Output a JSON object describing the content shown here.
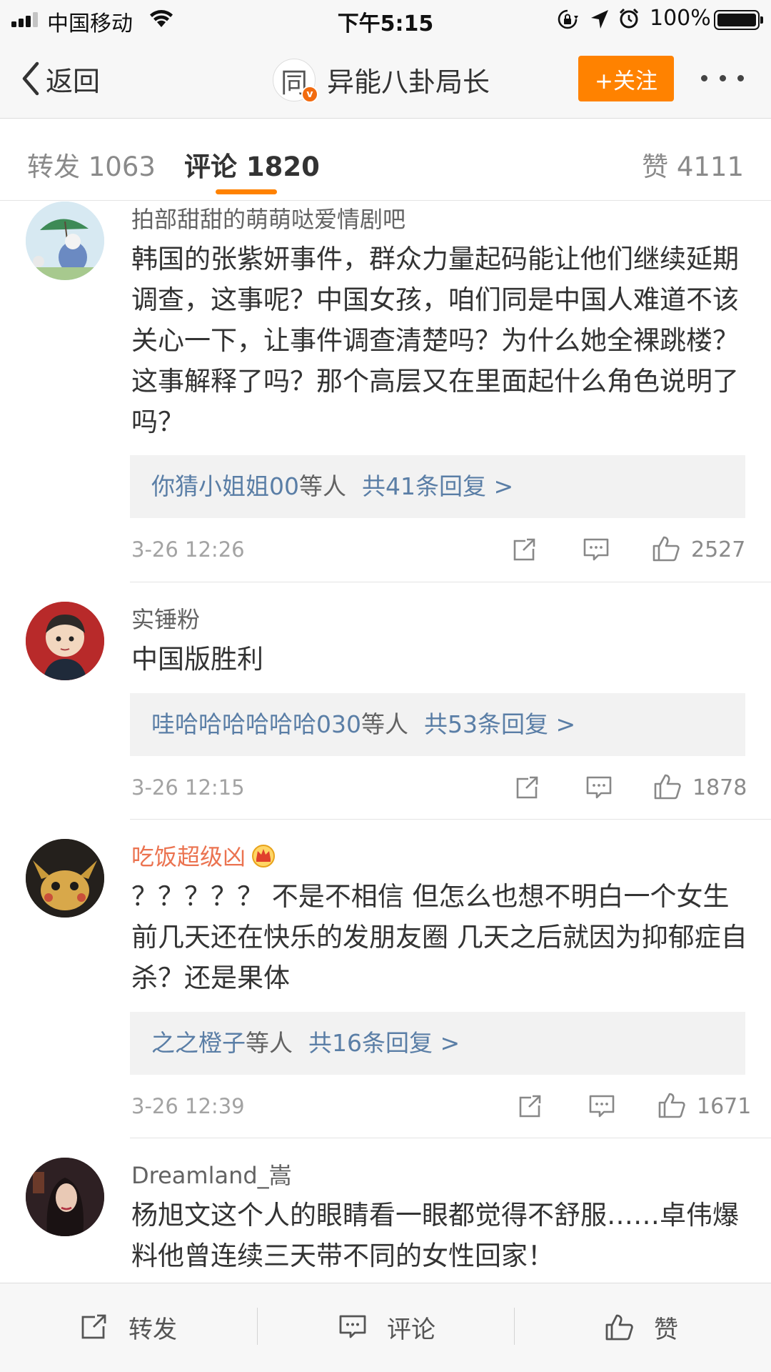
{
  "status_bar": {
    "carrier": "中国移动",
    "time": "下午5:15",
    "battery": "100%",
    "icons": [
      "signal-icon",
      "wifi-icon",
      "rotation-lock-icon",
      "location-icon",
      "alarm-icon",
      "battery-icon"
    ]
  },
  "nav": {
    "back_label": "返回",
    "avatar_glyph": "同",
    "title": "异能八卦局长",
    "follow_label": "+关注",
    "colors": {
      "accent": "#ff8200"
    }
  },
  "tabs": {
    "repost": "转发 1063",
    "comments": "评论 1820",
    "likes": "赞 4111",
    "active": "comments"
  },
  "comments": [
    {
      "user": "拍部甜甜的萌萌哒爱情剧吧",
      "text": "韩国的张紫妍事件，群众力量起码能让他们继续延期调查，这事呢？中国女孩，咱们同是中国人难道不该关心一下，让事件调查清楚吗？为什么她全裸跳楼？这事解释了吗？那个高层又在里面起什么角色说明了吗？",
      "reply_users": "你猜小姐姐00",
      "reply_others": "等人",
      "reply_count": "共41条回复 >",
      "time": "3-26 12:26",
      "likes": "2527"
    },
    {
      "user": "实锤粉",
      "text": "中国版胜利",
      "reply_users": "哇哈哈哈哈哈哈030",
      "reply_others": "等人",
      "reply_count": "共53条回复 >",
      "time": "3-26 12:15",
      "likes": "1878"
    },
    {
      "user": "吃饭超级凶",
      "text": "？？？？？ 不是不相信 但怎么也想不明白一个女生前几天还在快乐的发朋友圈 几天之后就因为抑郁症自杀？还是果体",
      "reply_users": "之之橙子",
      "reply_others": "等人",
      "reply_count": "共16条回复 >",
      "time": "3-26 12:39",
      "likes": "1671"
    },
    {
      "user": "Dreamland_嵩",
      "text": "杨旭文这个人的眼睛看一眼都觉得不舒服……卓伟爆料他曾连续三天带不同的女性回家！"
    }
  ],
  "bottom_bar": {
    "repost": "转发",
    "comment": "评论",
    "like": "赞"
  }
}
